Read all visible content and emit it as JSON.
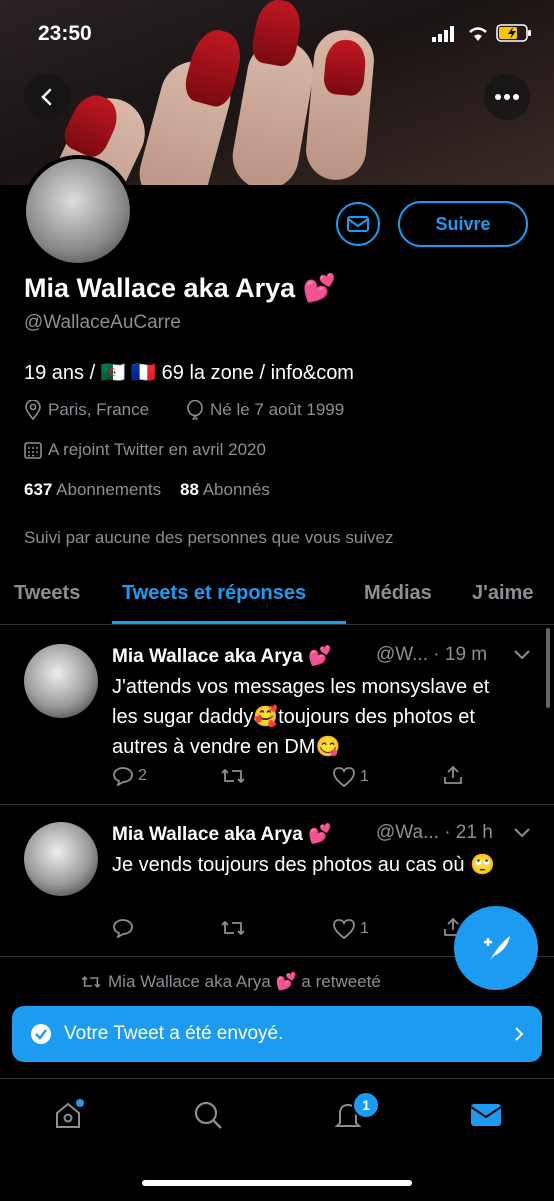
{
  "status_bar": {
    "time": "23:50"
  },
  "profile": {
    "name": "Mia Wallace aka Arya 💕",
    "handle": "@WallaceAuCarre",
    "bio": "19 ans / 🇩🇿 🇫🇷 69 la zone / info&com",
    "location": "Paris, France",
    "birthday": "Né le 7 août 1999",
    "joined": "A rejoint Twitter en avril 2020",
    "following_count": "637",
    "following_label": "Abonnements",
    "followers_count": "88",
    "followers_label": "Abonnés",
    "followed_by": "Suivi par aucune des personnes que vous suivez",
    "follow_label": "Suivre"
  },
  "tabs": [
    {
      "label": "Tweets"
    },
    {
      "label": "Tweets et réponses"
    },
    {
      "label": "Médias"
    },
    {
      "label": "J'aime"
    }
  ],
  "tweets": [
    {
      "name": "Mia Wallace aka Arya 💕",
      "meta": "@W... · 19 m",
      "text": "J'attends vos messages les monsyslave et les sugar daddy🥰toujours des photos et autres à vendre en DM😋",
      "replies": "2",
      "retweets": "",
      "likes": "1"
    },
    {
      "name": "Mia Wallace aka Arya 💕",
      "meta": "@Wa... · 21 h",
      "text": "Je vends toujours des photos au cas où 🙄",
      "replies": "",
      "retweets": "",
      "likes": "1"
    }
  ],
  "retweet_note": "Mia Wallace aka Arya 💕  a retweeté",
  "toast": {
    "text": "Votre Tweet a été envoyé."
  },
  "nav": {
    "notifications_badge": "1"
  },
  "colors": {
    "accent": "#1d9bf0",
    "background": "#000000",
    "muted": "#8a8f95"
  }
}
